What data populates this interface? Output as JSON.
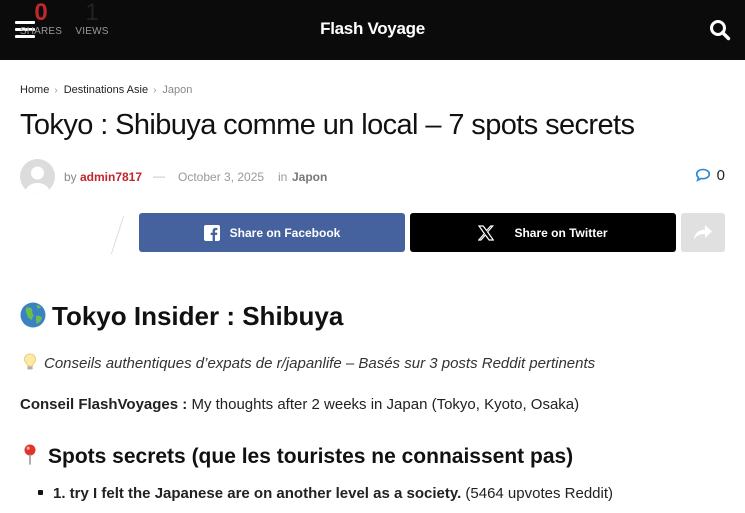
{
  "header": {
    "site_title": "Flash Voyage",
    "menu_icon": "hamburger-menu-icon",
    "search_icon": "search-icon",
    "background": "#0b0b0b"
  },
  "breadcrumb": {
    "items": [
      "Home",
      "Destinations Asie",
      "Japon"
    ]
  },
  "article": {
    "title": "Tokyo : Shibuya comme un local – 7 spots secrets",
    "by_label": "by",
    "author": "admin7817",
    "date": "October 3, 2025",
    "in_label": "in",
    "category": "Japon",
    "comment_count": "0",
    "accent_color": "#c1272d"
  },
  "stats": {
    "shares_value": "0",
    "shares_label": "SHARES",
    "views_value": "1",
    "views_label": "VIEWS"
  },
  "share": {
    "facebook_label": "Share on Facebook",
    "twitter_label": "Share on Twitter",
    "facebook_color": "#45629f",
    "twitter_color": "#000000",
    "more_icon": "share-arrow-icon"
  },
  "content": {
    "h2": "Tokyo Insider : Shibuya",
    "note": "Conseils authentiques d’expats de r/japanlife – Basés sur 3 posts Reddit pertinents",
    "tip_label": "Conseil FlashVoyages :",
    "tip_text": " My thoughts after 2 weeks in Japan (Tokyo, Kyoto, Osaka)",
    "h3": "Spots secrets (que les touristes ne connaissent pas)",
    "list": [
      {
        "bold": "1. try I felt the Japanese are on another level as a society.",
        "rest": " (5464 upvotes Reddit)"
      }
    ]
  }
}
